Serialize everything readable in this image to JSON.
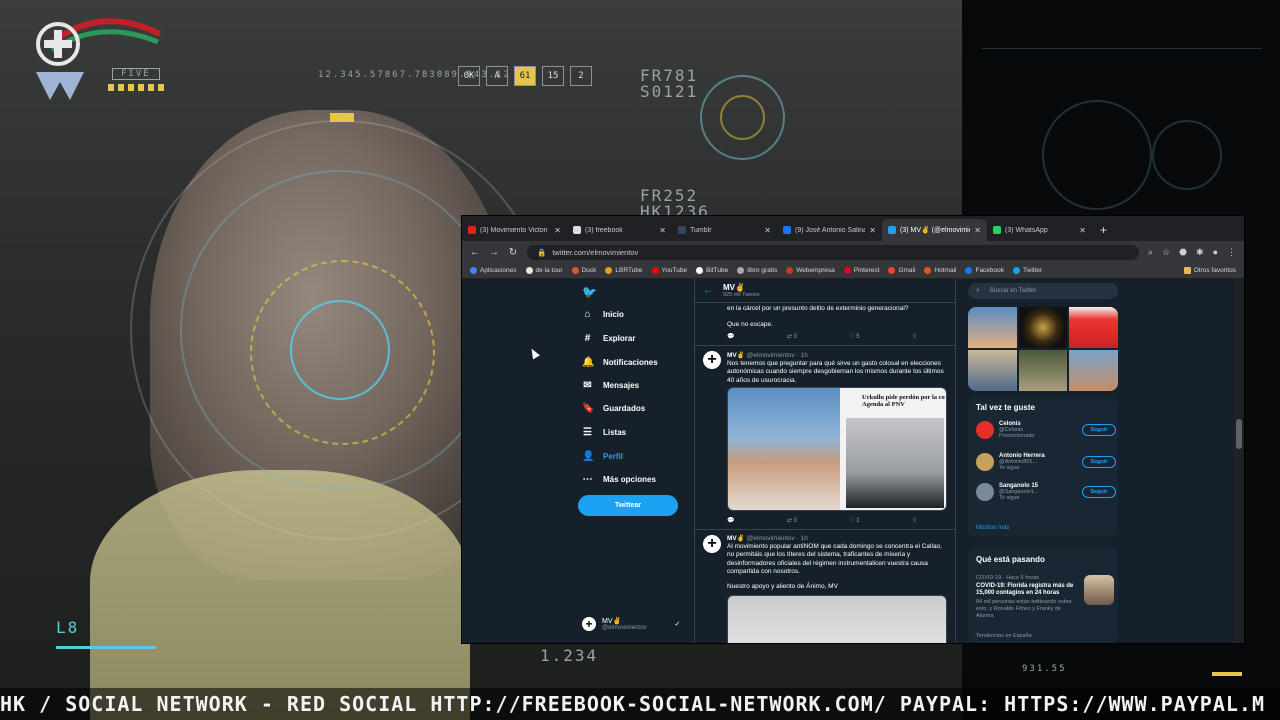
{
  "hud": {
    "top_code": "12.345.57867.783089.943.12",
    "mid_code_1": "FR781",
    "mid_code_2": "S0121",
    "right_code_1": "FR252",
    "right_code_2": "HK1236",
    "left_bottom": "L8",
    "bottom_mid": "1.234",
    "bottom_right": "931.55",
    "five_label": "FIVE",
    "boxes": [
      "0K",
      "A",
      "61",
      "15",
      "2"
    ],
    "highlight_box_index": 2
  },
  "ticker": {
    "text": "HK / SOCIAL NETWORK - RED SOCIAL HTTP://FREEBOOK-SOCIAL-NETWORK.COM/ PAYPAL: HTTPS://WWW.PAYPAL.M"
  },
  "browser": {
    "tabs": [
      {
        "label": "(3) Movimiento Victori",
        "color": "#e62117",
        "active": false
      },
      {
        "label": "(3) freebook",
        "color": "#dddddd",
        "active": false
      },
      {
        "label": "Tumblr",
        "color": "#36465d",
        "active": false
      },
      {
        "label": "(9) José Antonio Salina",
        "color": "#1877f2",
        "active": false
      },
      {
        "label": "(3) MV✌ (@elmovimie",
        "color": "#1da1f2",
        "active": true
      },
      {
        "label": "(3) WhatsApp",
        "color": "#25d366",
        "active": false
      }
    ],
    "url": "twitter.com/elmovimientov",
    "bookmarks": [
      {
        "label": "Aplicaciones",
        "color": "#4285f4"
      },
      {
        "label": "de la tour",
        "color": "#e8e8e8"
      },
      {
        "label": "Duck",
        "color": "#de5833"
      },
      {
        "label": "LBRTube",
        "color": "#e0a020"
      },
      {
        "label": "YouTube",
        "color": "#ff0000"
      },
      {
        "label": "BitTube",
        "color": "#ffffff"
      },
      {
        "label": "libro gratis",
        "color": "#aaaaaa"
      },
      {
        "label": "Webempresa",
        "color": "#c0392b"
      },
      {
        "label": "Pinterest",
        "color": "#e60023"
      },
      {
        "label": "Gmail",
        "color": "#ea4335"
      },
      {
        "label": "Hotmail",
        "color": "#f25022"
      },
      {
        "label": "Facebook",
        "color": "#1877f2"
      },
      {
        "label": "Twitter",
        "color": "#1da1f2"
      }
    ],
    "other_favorites": "Otros favoritos"
  },
  "twitter": {
    "nav": [
      {
        "label": "Inicio",
        "icon": "home-icon",
        "glyph": "⌂"
      },
      {
        "label": "Explorar",
        "icon": "hashtag-icon",
        "glyph": "#"
      },
      {
        "label": "Notificaciones",
        "icon": "bell-icon",
        "glyph": "🔔"
      },
      {
        "label": "Mensajes",
        "icon": "mail-icon",
        "glyph": "✉"
      },
      {
        "label": "Guardados",
        "icon": "bookmark-icon",
        "glyph": "🔖"
      },
      {
        "label": "Listas",
        "icon": "list-icon",
        "glyph": "☰"
      },
      {
        "label": "Perfil",
        "icon": "profile-icon",
        "glyph": "👤"
      },
      {
        "label": "Más opciones",
        "icon": "more-icon",
        "glyph": "⋯"
      }
    ],
    "tweet_button": "Twittear",
    "me": {
      "name": "MV✌",
      "handle": "@elmovimientov"
    },
    "header": {
      "name": "MV✌",
      "count": "925 mil Tweets"
    },
    "tweets": [
      {
        "text_tail": "en la cárcel por un presunto delito de exterminio generacional?",
        "text_tail2": "Que no escape.",
        "actions": [
          "",
          "3",
          "5",
          ""
        ]
      },
      {
        "name": "MV✌",
        "handle": "@elmovimientov · 1h",
        "text": "Nos tenemos que preguntar para qué sirve un gasto colosal en elecciones autonómicas cuando siempre desgobiernan los mismos durante los últimos 40 años de usurocracia.",
        "media_headline": "Urkullu pide perdón por la co Agenda al PNV",
        "actions": [
          "",
          "3",
          "2",
          ""
        ]
      },
      {
        "name": "MV✌",
        "handle": "@elmovimientov · 1h",
        "text": "Al movimiento popular antiNOM que cada domingo se concentra el Callao, no permitáis que los títeres del sistema, traficantes de miseria y desinformadores oficiales del régimen instrumentalicen vuestra causa compartida con nosotros.",
        "text2": "Nuestro apoyo y aliento de Ánimo, MV"
      }
    ],
    "search_placeholder": "Buscar en Twitter",
    "who_to_follow": {
      "title": "Tal vez te guste",
      "items": [
        {
          "name": "Celonis",
          "handle": "@Celonis",
          "extra": "Promocionado",
          "color": "#e5302a",
          "button": "Seguir"
        },
        {
          "name": "Antonio Herrera",
          "handle": "@Antonio805...",
          "extra": "Te sigue",
          "color": "#c8a25a",
          "button": "Seguir"
        },
        {
          "name": "Sanganolo 15",
          "handle": "@Sanganolo1...",
          "extra": "Te sigue",
          "color": "#7a8a99",
          "button": "Seguir"
        }
      ],
      "show_more": "Mostrar más"
    },
    "trends": {
      "title": "Qué está pasando",
      "category": "COVID-19 · Hace 5 horas",
      "headline": "COVID-19: Florida registra más de 15,000 contagios en 24 horas",
      "sub": "84 mil personas están twitteando sobre esto, y Ronaldo Fitnes y Franky de Alarma",
      "footer": "Tendencias en España"
    }
  }
}
